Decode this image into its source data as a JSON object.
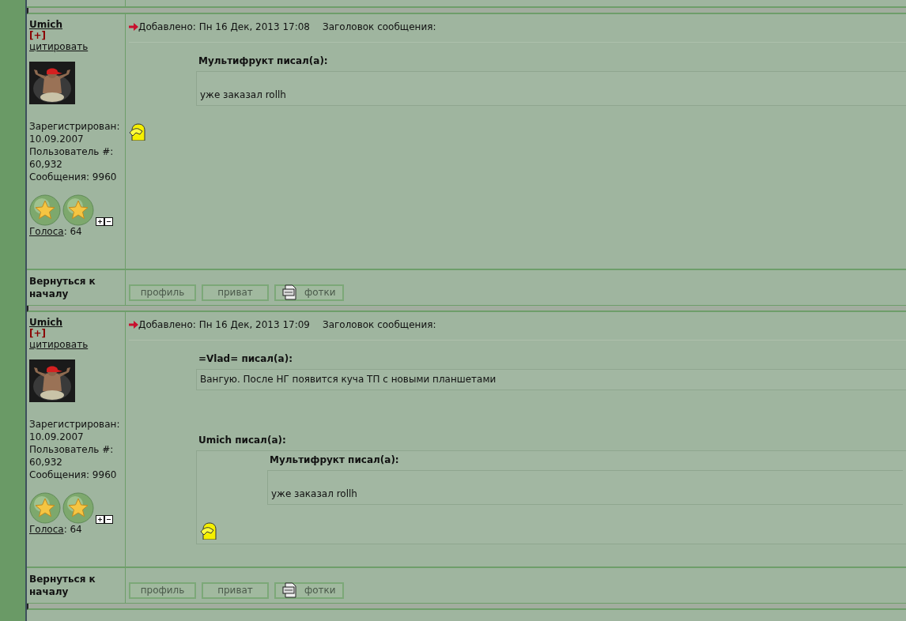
{
  "posts": [
    {
      "author": "Umich",
      "plus": "[+]",
      "quote_link": "цитировать",
      "stats": [
        "Зарегистрирован:",
        "10.09.2007",
        "Пользователь #:",
        "60,932",
        "Сообщения: 9960"
      ],
      "medals": [
        {
          "kind": "star"
        },
        {
          "kind": "star"
        }
      ],
      "votes_link": "Голоса",
      "votes_value": ": 64",
      "posted": "Добавлено: Пн 16 Дек, 2013 17:08",
      "subject_label": "Заголовок сообщения:",
      "body": [
        {
          "kind": "quote",
          "title": "Мультифрукт писал(а):",
          "content": [
            {
              "kind": "text",
              "text": "уже заказал rollh",
              "leading_blank": true
            }
          ]
        },
        {
          "kind": "smiley"
        }
      ],
      "back_label": "Вернуться к началу",
      "buttons": [
        {
          "label": "профиль",
          "kind": "plain"
        },
        {
          "label": "приват",
          "kind": "plain"
        },
        {
          "label": "фотки",
          "kind": "photos"
        }
      ]
    },
    {
      "author": "Umich",
      "plus": "[+]",
      "quote_link": "цитировать",
      "stats": [
        "Зарегистрирован:",
        "10.09.2007",
        "Пользователь #:",
        "60,932",
        "Сообщения: 9960"
      ],
      "medals": [
        {
          "kind": "star"
        },
        {
          "kind": "star"
        }
      ],
      "votes_link": "Голоса",
      "votes_value": ": 64",
      "posted": "Добавлено: Пн 16 Дек, 2013 17:09",
      "subject_label": "Заголовок сообщения:",
      "body": [
        {
          "kind": "quote",
          "title": "=Vlad= писал(а):",
          "content": [
            {
              "kind": "text",
              "text": "Вангую. После НГ появится куча ТП с новыми планшетами",
              "leading_blank": false
            }
          ]
        },
        {
          "kind": "quote",
          "title": "Umich писал(а):",
          "content": [
            {
              "kind": "quote",
              "title": "Мультифрукт писал(а):",
              "content": [
                {
                  "kind": "text",
                  "text": "уже заказал rollh",
                  "leading_blank": true
                }
              ]
            },
            {
              "kind": "smiley"
            }
          ]
        }
      ],
      "back_label": "Вернуться к началу",
      "buttons": [
        {
          "label": "профиль",
          "kind": "plain"
        },
        {
          "label": "приват",
          "kind": "plain"
        },
        {
          "label": "фотки",
          "kind": "photos"
        }
      ]
    }
  ]
}
